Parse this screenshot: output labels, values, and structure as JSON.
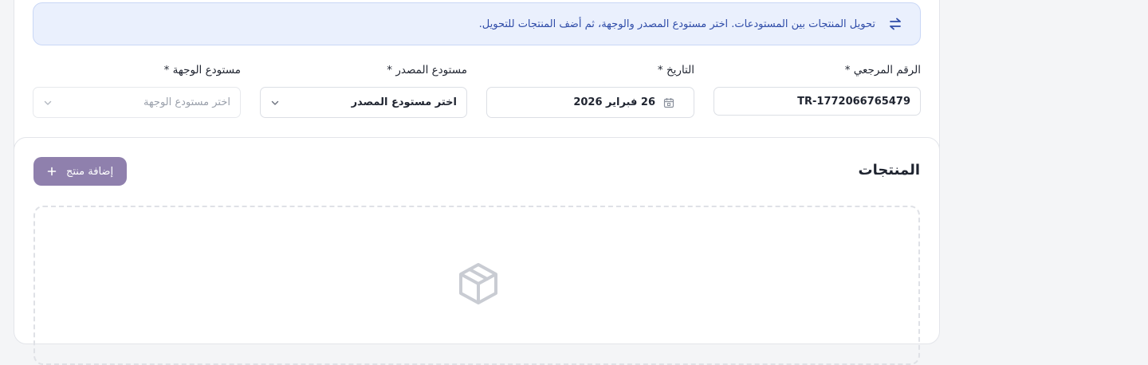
{
  "banner": {
    "text": "تحويل المنتجات بين المستودعات. اختر مستودع المصدر والوجهة، ثم أضف المنتجات للتحويل.",
    "icon": "transfer-arrows-icon"
  },
  "form": {
    "reference": {
      "label": "الرقم المرجعي *",
      "value": "TR-1772066765479"
    },
    "date": {
      "label": "التاريخ *",
      "value": "26 فبراير 2026",
      "icon": "calendar-icon"
    },
    "source": {
      "label": "مستودع المصدر *",
      "value": "اختر مستودع المصدر",
      "icon": "chevron-down-icon"
    },
    "destination": {
      "label": "مستودع الوجهة *",
      "placeholder": "اختر مستودع الوجهة",
      "icon": "chevron-down-icon"
    }
  },
  "products": {
    "title": "المنتجات",
    "add_button": "إضافة منتج",
    "empty_icon": "box-icon"
  },
  "colors": {
    "banner_bg": "#eaf0fd",
    "banner_text": "#2f4ca8",
    "add_button_bg": "#8f80ad"
  }
}
